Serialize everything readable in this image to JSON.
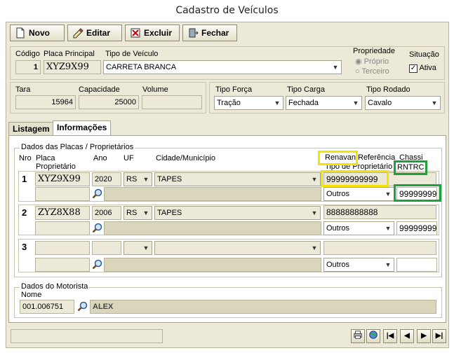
{
  "window": {
    "title": "Cadastro de Veículos"
  },
  "toolbar": {
    "novo": "Novo",
    "editar": "Editar",
    "excluir": "Excluir",
    "fechar": "Fechar"
  },
  "vehicle": {
    "codigo_label": "Código",
    "codigo": "1",
    "placa_label": "Placa Principal",
    "placa": "XYZ9X99",
    "tipo_label": "Tipo de Veículo",
    "tipo": "CARRETA BRANCA",
    "propriedade_label": "Propriedade",
    "proprio": "Próprio",
    "terceiro": "Terceiro",
    "situacao_label": "Situação",
    "ativa": "Ativa",
    "tara_label": "Tara",
    "tara": "15964",
    "capacidade_label": "Capacidade",
    "capacidade": "25000",
    "volume_label": "Volume",
    "volume": "",
    "tipo_forca_label": "Tipo Força",
    "tipo_forca": "Tração",
    "tipo_carga_label": "Tipo Carga",
    "tipo_carga": "Fechada",
    "tipo_rodado_label": "Tipo Rodado",
    "tipo_rodado": "Cavalo"
  },
  "tabs": [
    {
      "label": "Listagem"
    },
    {
      "label": "Informações"
    }
  ],
  "placas": {
    "group_title": "Dados das Placas / Proprietários",
    "headers": {
      "nro": "Nro",
      "placa": "Placa",
      "proprietario": "Proprietário",
      "ano": "Ano",
      "uf": "UF",
      "cidade": "Cidade/Município",
      "renavan": "Renavan",
      "referencia": "Referência",
      "chassi": "Chassi",
      "tipo_proprietario": "Tipo de Proprietário",
      "rntrc": "RNTRC"
    },
    "rows": [
      {
        "nro": "1",
        "placa": "XYZ9X99",
        "ano": "2020",
        "uf": "RS",
        "cidade": "TAPES",
        "renavan": "99999999999",
        "tipo_proprietario": "Outros",
        "rntrc": "99999999"
      },
      {
        "nro": "2",
        "placa": "ZYZ8X88",
        "ano": "2006",
        "uf": "RS",
        "cidade": "TAPES",
        "renavan": "88888888888",
        "tipo_proprietario": "Outros",
        "rntrc": "99999999"
      },
      {
        "nro": "3",
        "placa": "",
        "ano": "",
        "uf": "",
        "cidade": "",
        "renavan": "",
        "tipo_proprietario": "Outros",
        "rntrc": ""
      }
    ]
  },
  "motorista": {
    "group_title": "Dados do Motorista",
    "nome_label": "Nome",
    "codigo": "001.006751",
    "nome": "ALEX"
  },
  "colors": {
    "highlight_yellow": "#f4e400",
    "highlight_green": "#1fa13a"
  }
}
